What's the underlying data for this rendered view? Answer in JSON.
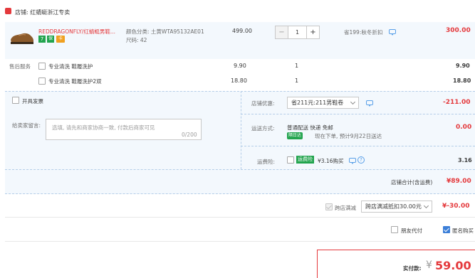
{
  "shop": {
    "name": "店铺: 红蜻蜓浙江专卖",
    "icon_color": "#e4393c"
  },
  "product": {
    "title": "REDDRAGONFLY/红蜻蜓男鞋...",
    "badges": [
      "7",
      "保",
      "卡"
    ],
    "spec_color": "颜色分类: 土黄WTA95132AE01",
    "spec_size": "尺码: 42",
    "unit_price": "499.00",
    "quantity": "1",
    "minus": "−",
    "plus": "+",
    "promotion": "省199:秋冬折扣",
    "subtotal": "300.00"
  },
  "services": {
    "label": "售后服务",
    "items": [
      {
        "name": "专业清洗 鞋履洗护",
        "price": "9.90",
        "qty": "1",
        "total": "9.90"
      },
      {
        "name": "专业清洗 鞋履洗护2双",
        "price": "18.80",
        "qty": "1",
        "total": "18.80"
      }
    ]
  },
  "invoice": {
    "label": "开具发票"
  },
  "message": {
    "label": "给卖家留言:",
    "placeholder": "选填, 请先和商家协商一致, 付款后商家可见",
    "counter": "0/200"
  },
  "shop_discount": {
    "label": "店铺优惠:",
    "selected": "省211元:211男鞋卷",
    "amount": "-211.00"
  },
  "delivery": {
    "label": "运送方式:",
    "method": "普通配送 快递 免邮",
    "badge": "隔日达",
    "eta": "现在下单, 预计9月22日送达",
    "amount": "0.00"
  },
  "insurance": {
    "label": "运费险:",
    "badge": "运费险",
    "text": "¥3.16购买",
    "amount": "3.16"
  },
  "shop_total": {
    "label": "店铺合计(含运费)",
    "amount": "¥89.00"
  },
  "cross_store": {
    "label": "跨店满减",
    "selected": "跨店满减抵扣30.00元",
    "amount": "¥-30.00"
  },
  "options": {
    "friend_pay": "朋友代付",
    "anonymous": "匿名购买"
  },
  "payment": {
    "label": "实付款:",
    "currency": "¥",
    "amount": "59.00"
  }
}
